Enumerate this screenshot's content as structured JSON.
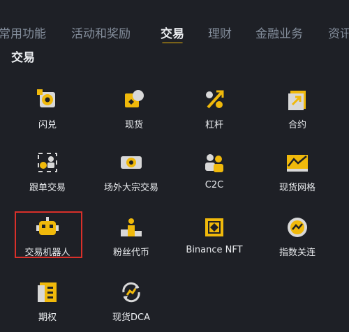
{
  "tabs": [
    {
      "label": "常用功能",
      "active": false
    },
    {
      "label": "活动和奖励",
      "active": false
    },
    {
      "label": "交易",
      "active": true
    },
    {
      "label": "理财",
      "active": false
    },
    {
      "label": "金融业务",
      "active": false
    },
    {
      "label": "资讯",
      "active": false
    }
  ],
  "section_title": "交易",
  "items": [
    {
      "label": "闪兑",
      "icon": "convert-icon"
    },
    {
      "label": "现货",
      "icon": "spot-icon"
    },
    {
      "label": "杠杆",
      "icon": "margin-icon"
    },
    {
      "label": "合约",
      "icon": "futures-icon"
    },
    {
      "label": "跟单交易",
      "icon": "copy-trading-icon"
    },
    {
      "label": "场外大宗交易",
      "icon": "otc-block-trade-icon"
    },
    {
      "label": "C2C",
      "icon": "c2c-icon"
    },
    {
      "label": "现货网格",
      "icon": "spot-grid-icon"
    },
    {
      "label": "交易机器人",
      "icon": "trading-bot-icon",
      "highlighted": true
    },
    {
      "label": "粉丝代币",
      "icon": "fan-token-icon"
    },
    {
      "label": "Binance NFT",
      "icon": "nft-icon"
    },
    {
      "label": "指数关连",
      "icon": "index-linked-icon"
    },
    {
      "label": "期权",
      "icon": "options-icon"
    },
    {
      "label": "现货DCA",
      "icon": "spot-dca-icon"
    }
  ],
  "colors": {
    "background": "#1e2026",
    "accent": "#f0b90b",
    "icon_gray": "#d8d8d8",
    "highlight": "#d9302a"
  }
}
